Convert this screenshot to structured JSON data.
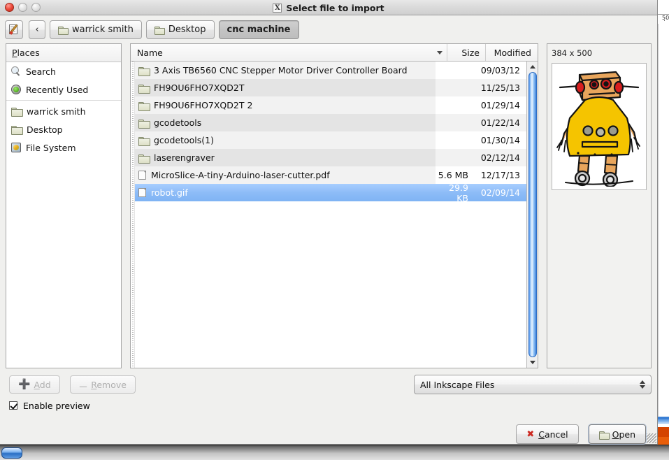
{
  "window": {
    "title": "Select file to import",
    "title_icon": "x-window-icon",
    "lights": [
      "close-button",
      "minimize-button",
      "maximize-button"
    ]
  },
  "pathbar": {
    "type_name_button_icon": "edit-filename-icon",
    "back_button_label": "‹",
    "crumbs": [
      {
        "label": "warrick smith",
        "active": false,
        "icon": "folder-icon"
      },
      {
        "label": "Desktop",
        "active": false,
        "icon": "folder-icon"
      },
      {
        "label": "cnc machine",
        "active": true,
        "icon": "none"
      }
    ]
  },
  "sidebar": {
    "header": "Places",
    "header_accel": "P",
    "items": [
      {
        "label": "Search",
        "icon": "search-icon"
      },
      {
        "label": "Recently Used",
        "icon": "recent-clock-icon"
      },
      {
        "label": "warrick smith",
        "icon": "folder-icon"
      },
      {
        "label": "Desktop",
        "icon": "folder-icon"
      },
      {
        "label": "File System",
        "icon": "harddisk-icon"
      }
    ]
  },
  "filelist": {
    "columns": [
      "Name",
      "Size",
      "Modified"
    ],
    "sort_indicator": "chevron-down-icon",
    "rows": [
      {
        "name": "3 Axis TB6560 CNC Stepper Motor Driver Controller Board",
        "size": "",
        "modified": "09/03/12",
        "kind": "folder",
        "selected": false
      },
      {
        "name": "FH9OU6FHO7XQD2T",
        "size": "",
        "modified": "11/25/13",
        "kind": "folder",
        "selected": false
      },
      {
        "name": "FH9OU6FHO7XQD2T 2",
        "size": "",
        "modified": "01/29/14",
        "kind": "folder",
        "selected": false
      },
      {
        "name": "gcodetools",
        "size": "",
        "modified": "01/22/14",
        "kind": "folder",
        "selected": false
      },
      {
        "name": "gcodetools(1)",
        "size": "",
        "modified": "01/30/14",
        "kind": "folder",
        "selected": false
      },
      {
        "name": "laserengraver",
        "size": "",
        "modified": "02/12/14",
        "kind": "folder",
        "selected": false
      },
      {
        "name": "MicroSlice-A-tiny-Arduino-laser-cutter.pdf",
        "size": "5.6 MB",
        "modified": "12/17/13",
        "kind": "file",
        "selected": false
      },
      {
        "name": "robot.gif",
        "size": "29.9 KB",
        "modified": "02/09/14",
        "kind": "file",
        "selected": true
      }
    ],
    "selection_color": "#8dbcf7",
    "scrollbar_color": "#3d82dd"
  },
  "preview": {
    "dimensions": "384 x 500",
    "image_name": "robot-illustration",
    "colors": {
      "body": "#F5C400",
      "head": "#E8A55C",
      "eyes": "#D81E1E",
      "buttons": "#9C9C8C",
      "outline": "#141414",
      "wheels": "#A0A0A0"
    }
  },
  "footer": {
    "add_button": {
      "label": "Add",
      "accel": "A",
      "icon": "plus-icon",
      "enabled": false
    },
    "remove_button": {
      "label": "Remove",
      "accel": "R",
      "icon": "minus-icon",
      "enabled": false
    },
    "filter": {
      "value": "All Inkscape Files",
      "icon": "updown-chevron-icon"
    },
    "enable_preview": {
      "label": "Enable preview",
      "checked": true
    },
    "cancel_button": {
      "label": "Cancel",
      "accel": "C",
      "icon": "x-icon"
    },
    "open_button": {
      "label": "Open",
      "accel": "O",
      "icon": "folder-icon"
    }
  },
  "backdrop": {
    "ruler_tick_label": "50",
    "ruler_ticks": ". .",
    "swatch_colors": [
      "#3a7fd5",
      "#6fa8e8",
      "#a9ccf2",
      "#ffffff",
      "#d44400",
      "#e85e0a"
    ]
  }
}
